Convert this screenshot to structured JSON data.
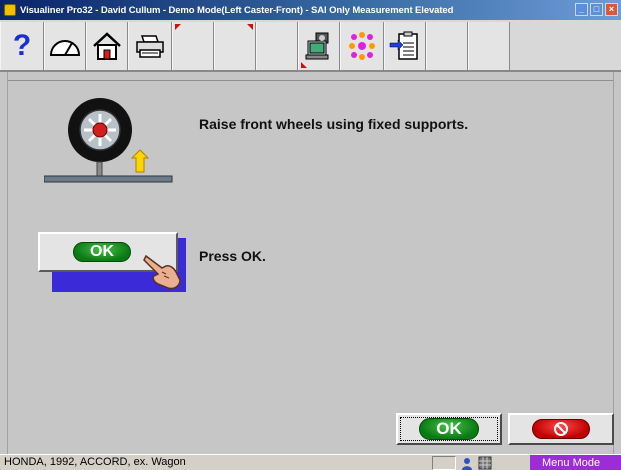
{
  "window": {
    "title": "Visualiner Pro32 - David Cullum - Demo Mode(Left Caster-Front)  -  SAI Only Measurement Elevated"
  },
  "toolbar": {
    "buttons": [
      {
        "name": "help",
        "icon": "question-mark-icon"
      },
      {
        "name": "gauge",
        "icon": "gauge-icon"
      },
      {
        "name": "home",
        "icon": "home-icon"
      },
      {
        "name": "print",
        "icon": "printer-icon"
      },
      {
        "name": "blank1",
        "icon": ""
      },
      {
        "name": "blank2",
        "icon": ""
      },
      {
        "name": "blank3",
        "icon": ""
      },
      {
        "name": "camera",
        "icon": "camera-computer-icon"
      },
      {
        "name": "dots",
        "icon": "dots-icon"
      },
      {
        "name": "clipboard",
        "icon": "clipboard-arrow-icon"
      },
      {
        "name": "blank4",
        "icon": ""
      },
      {
        "name": "blank5",
        "icon": ""
      }
    ]
  },
  "main": {
    "instruction_1": "Raise front wheels using fixed supports.",
    "instruction_2": "Press OK.",
    "ok_big_label": "OK"
  },
  "footer_buttons": {
    "ok_label": "OK"
  },
  "statusbar": {
    "vehicle": "HONDA, 1992, ACCORD, ex. Wagon",
    "mode": "Menu Mode"
  },
  "colors": {
    "ok_green": "#0a7a14",
    "cancel_red": "#c00000",
    "mode_purple": "#9c2bd8",
    "accent_blue": "#3a2ad8"
  }
}
